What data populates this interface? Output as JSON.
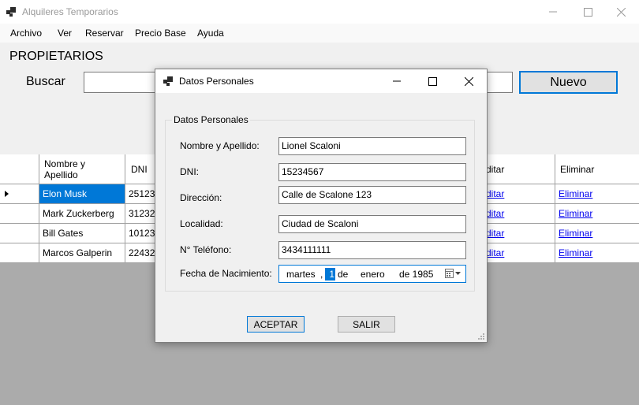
{
  "window": {
    "title": "Alquileres Temporarios"
  },
  "menu": {
    "items": [
      "Archivo",
      "Ver",
      "Reservar",
      "Precio Base",
      "Ayuda"
    ]
  },
  "main": {
    "section_title": "PROPIETARIOS",
    "search_label": "Buscar",
    "search_value": "",
    "new_button": "Nuevo"
  },
  "grid": {
    "columns": [
      "Nombre y Apellido",
      "DNI",
      "Editar",
      "Eliminar"
    ],
    "rows": [
      {
        "name": "Elon Musk",
        "dni": "251231",
        "edit": "Editar",
        "delete": "Eliminar",
        "selected": true
      },
      {
        "name": "Mark Zuckerberg",
        "dni": "312321",
        "edit": "Editar",
        "delete": "Eliminar",
        "selected": false
      },
      {
        "name": "Bill Gates",
        "dni": "101231",
        "edit": "Editar",
        "delete": "Eliminar",
        "selected": false
      },
      {
        "name": "Marcos Galperin",
        "dni": "224323",
        "edit": "Editar",
        "delete": "Eliminar",
        "selected": false
      }
    ]
  },
  "dialog": {
    "title": "Datos Personales",
    "group_title": "Datos Personales",
    "fields": {
      "name": {
        "label": "Nombre y Apellido:",
        "value": "Lionel Scaloni"
      },
      "dni": {
        "label": "DNI:",
        "value": "15234567"
      },
      "address": {
        "label": "Dirección:",
        "value": "Calle de Scalone 123"
      },
      "city": {
        "label": "Localidad:",
        "value": "Ciudad de Scaloni"
      },
      "phone": {
        "label": "N° Teléfono:",
        "value": "3434111111"
      }
    },
    "birthdate": {
      "label": "Fecha de Nacimiento:",
      "weekday": "martes",
      "sep": ",",
      "day": "1",
      "de1": "de",
      "month": "enero",
      "de_year": "de 1985"
    },
    "accept_button": "ACEPTAR",
    "exit_button": "SALIR"
  },
  "colors": {
    "accent": "#0078d7",
    "link": "#0000ee",
    "background_gray": "#ababab"
  },
  "icons": [
    "app-icon",
    "minimize-icon",
    "maximize-icon",
    "close-icon",
    "calendar-icon",
    "dropdown-arrow-icon",
    "row-indicator-icon",
    "size-grip-icon"
  ]
}
